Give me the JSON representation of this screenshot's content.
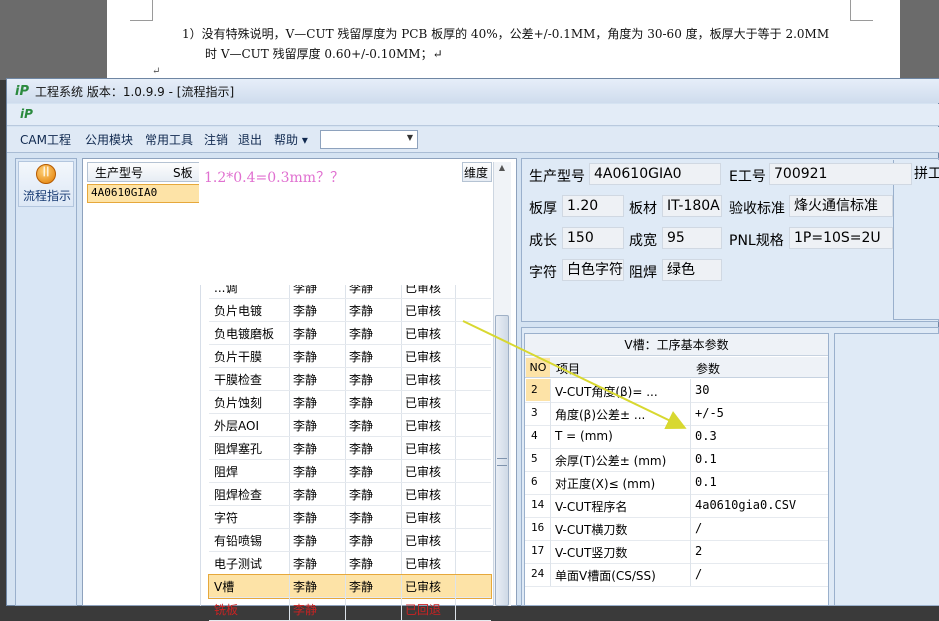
{
  "document": {
    "line1": "1）没有特殊说明，V—CUT 残留厚度为 PCB 板厚的 40%，公差+/-0.1MM，角度为 30-60 度，板厚大于等于 2.0MM",
    "line2": "时 V—CUT 残留厚度 0.60+/-0.10MM；↵",
    "para_mark": "↵"
  },
  "window": {
    "title": "工程系统  版本：1.0.9.9 - [流程指示]"
  },
  "menu": {
    "items": [
      "CAM工程",
      "公用模块",
      "常用工具",
      "注销",
      "退出",
      "帮助 ▾"
    ],
    "combo_value": ""
  },
  "left_panel": {
    "flow_button_label": "流程指示"
  },
  "product_grid": {
    "col1": "生产型号",
    "col2": "S板",
    "right_header": "维度",
    "row_value": "4A0610GIA0"
  },
  "note": "1.2*0.4=0.3mm？？",
  "process_rows": [
    {
      "step": "...调",
      "a": "李静",
      "b": "李静",
      "status": "已审核"
    },
    {
      "step": "负片电镀",
      "a": "李静",
      "b": "李静",
      "status": "已审核"
    },
    {
      "step": "负电镀磨板",
      "a": "李静",
      "b": "李静",
      "status": "已审核"
    },
    {
      "step": "负片干膜",
      "a": "李静",
      "b": "李静",
      "status": "已审核"
    },
    {
      "step": "干膜检查",
      "a": "李静",
      "b": "李静",
      "status": "已审核"
    },
    {
      "step": "负片蚀刻",
      "a": "李静",
      "b": "李静",
      "status": "已审核"
    },
    {
      "step": "外层AOI",
      "a": "李静",
      "b": "李静",
      "status": "已审核"
    },
    {
      "step": "阻焊塞孔",
      "a": "李静",
      "b": "李静",
      "status": "已审核"
    },
    {
      "step": "阻焊",
      "a": "李静",
      "b": "李静",
      "status": "已审核"
    },
    {
      "step": "阻焊检查",
      "a": "李静",
      "b": "李静",
      "status": "已审核"
    },
    {
      "step": "字符",
      "a": "李静",
      "b": "李静",
      "status": "已审核"
    },
    {
      "step": "有铅喷锡",
      "a": "李静",
      "b": "李静",
      "status": "已审核"
    },
    {
      "step": "电子测试",
      "a": "李静",
      "b": "李静",
      "status": "已审核"
    },
    {
      "step": "V槽",
      "a": "李静",
      "b": "李静",
      "status": "已审核"
    },
    {
      "step": "铣板",
      "a": "李静",
      "b": "",
      "status": "已回退"
    }
  ],
  "info": {
    "model_label": "生产型号",
    "model_value": "4A0610GIA0",
    "eno_label": "E工号",
    "eno_value": "700921",
    "pin_label": "拼工",
    "thick_label": "板厚",
    "thick_value": "1.20",
    "material_label": "板材",
    "material_value": "IT-180A",
    "standard_label": "验收标准",
    "standard_value": "烽火通信标准",
    "length_label": "成长",
    "length_value": "150",
    "width_label": "成宽",
    "width_value": "95",
    "pnl_label": "PNL规格",
    "pnl_value": "1P=10S=2U",
    "char_label": "字符",
    "char_value": "白色字符",
    "mask_label": "阻焊",
    "mask_value": "绿色"
  },
  "params": {
    "title": "V槽：工序基本参数",
    "head_no": "NO",
    "head_item": "项目",
    "head_value": "参数",
    "rows": [
      {
        "no": "2",
        "item": "V-CUT角度(β)=  ...",
        "value": "30"
      },
      {
        "no": "3",
        "item": "角度(β)公差±  ...",
        "value": "+/-5"
      },
      {
        "no": "4",
        "item": "T =  (mm)",
        "value": "0.3"
      },
      {
        "no": "5",
        "item": "余厚(T)公差±  (mm)",
        "value": "0.1"
      },
      {
        "no": "6",
        "item": "对正度(X)≤ (mm)",
        "value": "0.1"
      },
      {
        "no": "14",
        "item": "V-CUT程序名",
        "value": "4a0610gia0.CSV"
      },
      {
        "no": "16",
        "item": "V-CUT横刀数",
        "value": "/"
      },
      {
        "no": "17",
        "item": "V-CUT竖刀数",
        "value": "2"
      },
      {
        "no": "24",
        "item": "单面V槽面(CS/SS)",
        "value": "/"
      }
    ]
  },
  "colors": {
    "selection": "#fde3a7",
    "arrow": "#d8d830",
    "note": "#e070d0"
  }
}
